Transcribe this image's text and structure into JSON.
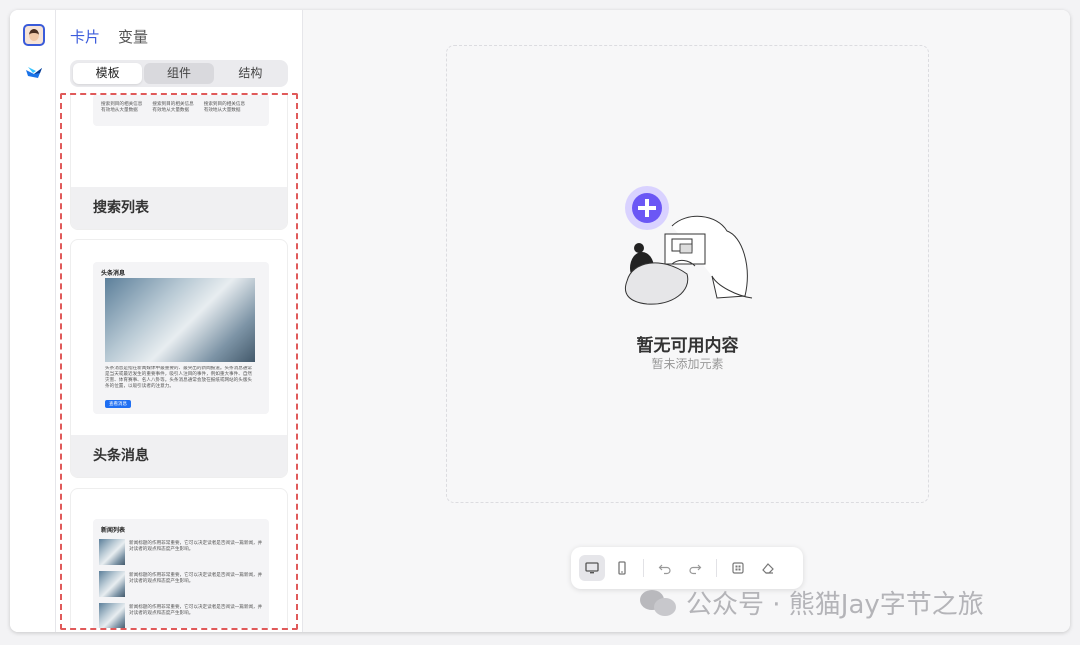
{
  "panel": {
    "top_tabs": [
      "卡片",
      "变量"
    ],
    "segments": [
      "模板",
      "组件",
      "结构"
    ]
  },
  "templates": {
    "search_list": {
      "label": "搜索列表",
      "preview_lines": [
        "搜索到目的相关信息",
        "有效地从大量数据"
      ]
    },
    "headline": {
      "label": "头条消息",
      "preview_title": "头条消息",
      "preview_text": "头条消息是指在新闻媒体中最重要的、最突出的新闻报道。头条消息通常是当天或最近发生的重要事件，吸引人注目的事件，例如重大事件、自然灾害、体育赛事、名人八卦等。头条消息通常会放在报纸或网站的头版头条的位置，以吸引读者的注意力。",
      "preview_button": "查看消息"
    },
    "news_list": {
      "preview_title": "新闻列表",
      "item_text": "新闻标题的作用非常重要，它可以决定读者是否阅读一篇新闻，并对读者的观点和态度产生影响。"
    }
  },
  "empty_state": {
    "title": "暂无可用内容",
    "subtitle": "暂未添加元素"
  },
  "toolbar": {
    "icons": [
      "desktop-icon",
      "mobile-icon",
      "undo-icon",
      "redo-icon",
      "grid-icon",
      "eraser-icon"
    ]
  },
  "watermark": {
    "text": "公众号 · 熊猫Jay字节之旅"
  },
  "colors": {
    "accent": "#3b5bdb",
    "illustration_purple": "#6b57f5",
    "selection_dashed": "#e05a5a"
  }
}
